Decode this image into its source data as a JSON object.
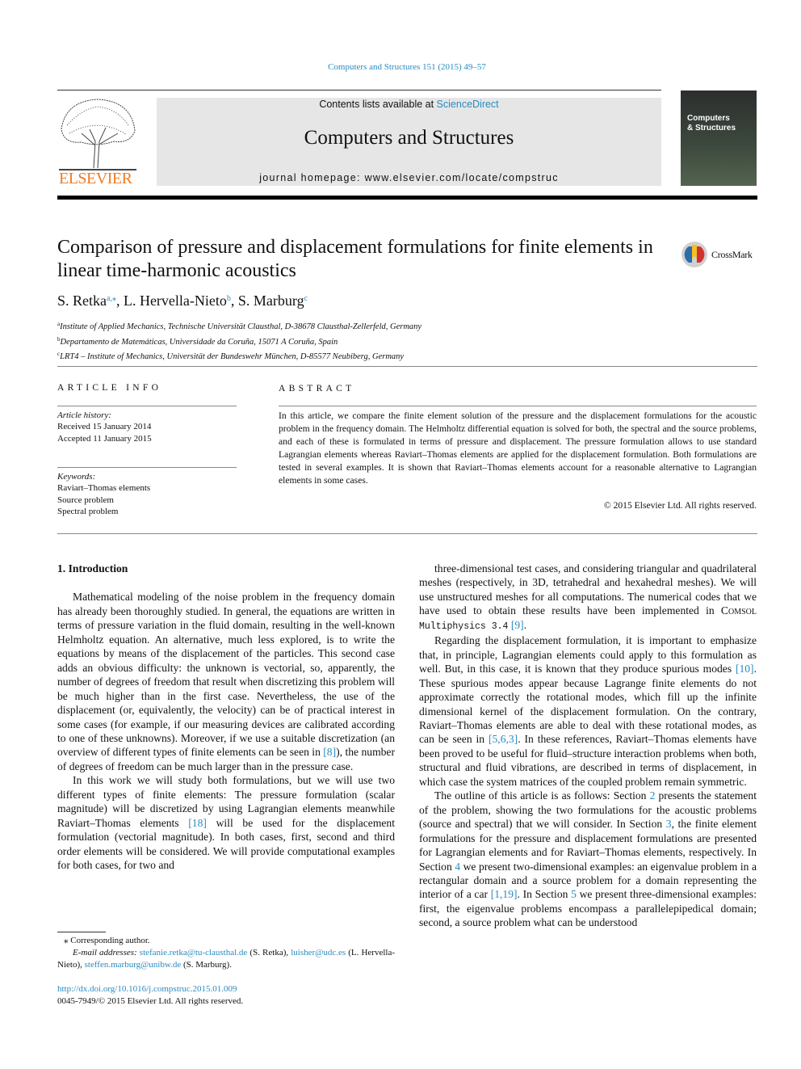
{
  "header": {
    "journal_ref": "Computers and Structures 151 (2015) 49–57",
    "contents_prefix": "Contents lists available at ",
    "contents_link": "ScienceDirect",
    "journal_title": "Computers and Structures",
    "homepage": "journal homepage: www.elsevier.com/locate/compstruc",
    "publisher_logo": "ELSEVIER",
    "cover_title_1": "Computers",
    "cover_title_2": "& Structures",
    "crossmark": "CrossMark",
    "colors": {
      "link": "#2a8bc0",
      "elsevier_orange": "#f07b20",
      "banner_bg": "#e6e6e6"
    }
  },
  "article": {
    "title": "Comparison of pressure and displacement formulations for finite elements in linear time-harmonic acoustics",
    "authors": [
      {
        "name": "S. Retka",
        "sup": "a,⁎"
      },
      {
        "name": "L. Hervella-Nieto",
        "sup": "b"
      },
      {
        "name": "S. Marburg",
        "sup": "c"
      }
    ],
    "affiliations": [
      {
        "key": "a",
        "text": "Institute of Applied Mechanics, Technische Universität Clausthal, D-38678 Clausthal-Zellerfeld, Germany"
      },
      {
        "key": "b",
        "text": "Departamento de Matemáticas, Universidade da Coruña, 15071 A Coruña, Spain"
      },
      {
        "key": "c",
        "text": "LRT4 – Institute of Mechanics, Universität der Bundeswehr München, D-85577 Neubiberg, Germany"
      }
    ]
  },
  "article_info": {
    "heading": "ARTICLE INFO",
    "history_label": "Article history:",
    "received": "Received 15 January 2014",
    "accepted": "Accepted 11 January 2015",
    "keywords_label": "Keywords:",
    "keywords": [
      "Raviart–Thomas elements",
      "Source problem",
      "Spectral problem"
    ]
  },
  "abstract": {
    "heading": "ABSTRACT",
    "text": "In this article, we compare the finite element solution of the pressure and the displacement formulations for the acoustic problem in the frequency domain. The Helmholtz differential equation is solved for both, the spectral and the source problems, and each of these is formulated in terms of pressure and displacement. The pressure formulation allows to use standard Lagrangian elements whereas Raviart–Thomas elements are applied for the displacement formulation. Both formulations are tested in several examples. It is shown that Raviart–Thomas elements account for a reasonable alternative to Lagrangian elements in some cases.",
    "copyright": "© 2015 Elsevier Ltd. All rights reserved."
  },
  "body": {
    "section_heading": "1. Introduction",
    "left_paragraphs": [
      [
        {
          "t": "Mathematical modeling of the noise problem in the frequency domain has already been thoroughly studied. In general, the equations are written in terms of pressure variation in the fluid domain, resulting in the well-known Helmholtz equation. An alternative, much less explored, is to write the equations by means of the displacement of the particles. This second case adds an obvious difficulty: the unknown is vectorial, so, apparently, the number of degrees of freedom that result when discretizing this problem will be much higher than in the first case. Nevertheless, the use of the displacement (or, equivalently, the velocity) can be of practical interest in some cases (for example, if our measuring devices are calibrated according to one of these unknowns). Moreover, if we use a suitable discretization (an overview of different types of finite elements can be seen in "
        },
        {
          "t": "[8]",
          "link": true
        },
        {
          "t": "), the number of degrees of freedom can be much larger than in the pressure case."
        }
      ],
      [
        {
          "t": "In this work we will study both formulations, but we will use two different types of finite elements: The pressure formulation (scalar magnitude) will be discretized by using Lagrangian elements meanwhile Raviart–Thomas elements "
        },
        {
          "t": "[18]",
          "link": true
        },
        {
          "t": " will be used for the displacement formulation (vectorial magnitude). In both cases, first, second and third order elements will be considered. We will provide computational examples for both cases, for two and"
        }
      ]
    ],
    "right_paragraphs": [
      [
        {
          "t": "three-dimensional test cases, and considering triangular and quadrilateral meshes (respectively, in 3D, tetrahedral and hexahedral meshes). We will use unstructured meshes for all computations. The numerical codes that we have used to obtain these results have been implemented in "
        },
        {
          "t": "Comsol",
          "sc": true
        },
        {
          "t": " "
        },
        {
          "t": "Multiphysics 3.4",
          "mono": true
        },
        {
          "t": " "
        },
        {
          "t": "[9]",
          "link": true
        },
        {
          "t": "."
        }
      ],
      [
        {
          "t": "Regarding the displacement formulation, it is important to emphasize that, in principle, Lagrangian elements could apply to this formulation as well. But, in this case, it is known that they produce spurious modes "
        },
        {
          "t": "[10]",
          "link": true
        },
        {
          "t": ". These spurious modes appear because Lagrange finite elements do not approximate correctly the rotational modes, which fill up the infinite dimensional kernel of the displacement formulation. On the contrary, Raviart–Thomas elements are able to deal with these rotational modes, as can be seen in "
        },
        {
          "t": "[5,6,3]",
          "link": true
        },
        {
          "t": ". In these references, Raviart–Thomas elements have been proved to be useful for fluid–structure interaction problems when both, structural and fluid vibrations, are described in terms of displacement, in which case the system matrices of the coupled problem remain symmetric."
        }
      ],
      [
        {
          "t": "The outline of this article is as follows: Section "
        },
        {
          "t": "2",
          "link": true
        },
        {
          "t": " presents the statement of the problem, showing the two formulations for the acoustic problems (source and spectral) that we will consider. In Section "
        },
        {
          "t": "3",
          "link": true
        },
        {
          "t": ", the finite element formulations for the pressure and displacement formulations are presented for Lagrangian elements and for Raviart–Thomas elements, respectively. In Section "
        },
        {
          "t": "4",
          "link": true
        },
        {
          "t": " we present two-dimensional examples: an eigenvalue problem in a rectangular domain and a source problem for a domain representing the interior of a car "
        },
        {
          "t": "[1,19]",
          "link": true
        },
        {
          "t": ". In Section "
        },
        {
          "t": "5",
          "link": true
        },
        {
          "t": " we present three-dimensional examples: first, the eigenvalue problems encompass a parallelepipedical domain; second, a source problem what can be understood"
        }
      ]
    ]
  },
  "footnote": {
    "corresponding": "⁎ Corresponding author.",
    "email_label": "E-mail addresses:",
    "emails": [
      {
        "email": "stefanie.retka@tu-clausthal.de",
        "who": "(S. Retka),"
      },
      {
        "email": "luisher@udc.es",
        "who": "(L. Hervella-Nieto),"
      },
      {
        "email": "steffen.marburg@unibw.de",
        "who": "(S. Marburg)."
      }
    ],
    "doi": "http://dx.doi.org/10.1016/j.compstruc.2015.01.009",
    "issn": "0045-7949/© 2015 Elsevier Ltd. All rights reserved."
  }
}
